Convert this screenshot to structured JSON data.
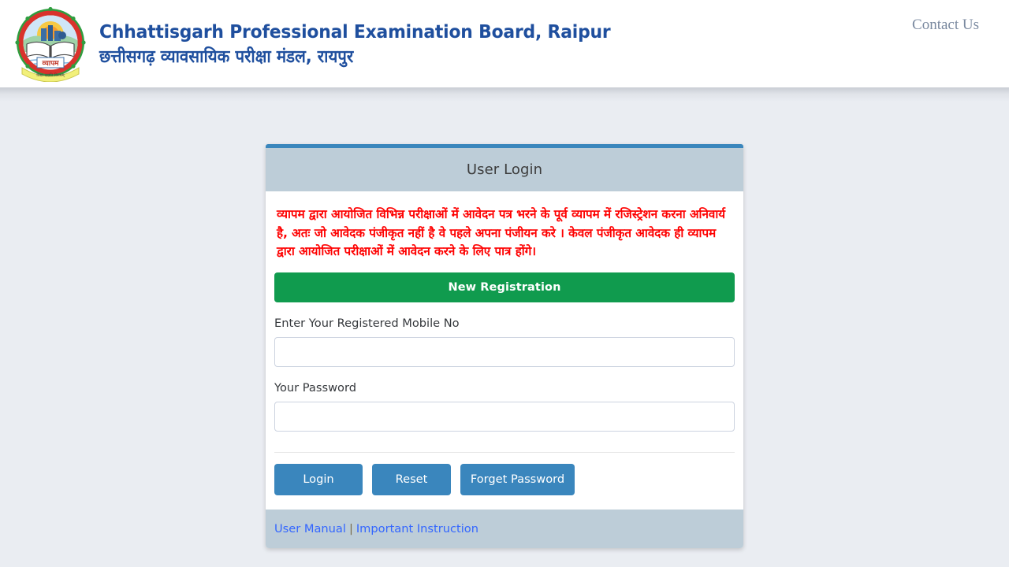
{
  "header": {
    "logo_icon": "cgvyapam-emblem-icon",
    "logo_caption": "व्यापम",
    "title_en": "Chhattisgarh Professional Examination Board, Raipur",
    "title_hi": "छत्तीसगढ़ व्यावसायिक परीक्षा मंडल, रायपुर",
    "contact_link": "Contact Us",
    "title_color": "#1f4f9e"
  },
  "login_card": {
    "header_title": "User Login",
    "top_border_color": "#3a86bd",
    "header_bg": "#bdcdd8",
    "notice_text": "व्यापम द्वारा आयोजित विभिन्न  परीक्षाओं में आवेदन पत्र भरने के पूर्व व्यापम में रजिस्ट्रेशन करना अनिवार्य है, अतः जो आवेदक पंजीकृत नहीं है वे पहले अपना  पंजीयन करे ।  केवल पंजीकृत आवेदक ही व्यापम द्वारा आयोजित परीक्षाओं में आवेदन करने के लिए पात्र होंगे।",
    "notice_color": "#fe0000",
    "register_button": "New Registration",
    "register_button_color": "#109b4e",
    "mobile_label": "Enter Your Registered Mobile No",
    "mobile_value": "",
    "mobile_placeholder": "",
    "password_label": "Your Password",
    "password_value": "",
    "password_placeholder": "",
    "login_button": "Login",
    "reset_button": "Reset",
    "forget_button": "Forget Password",
    "action_button_color": "#3a86bd",
    "footer": {
      "user_manual_link": "User Manual",
      "separator": "|",
      "important_instruction_link": "Important Instruction",
      "link_color": "#3366ff"
    }
  },
  "page": {
    "background": "#eaedf2"
  }
}
